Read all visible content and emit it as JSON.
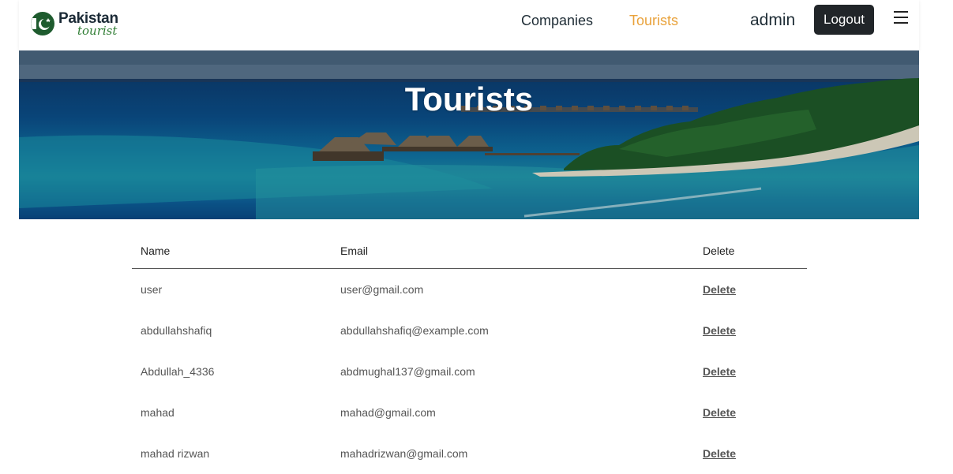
{
  "brand": {
    "main": "Pakistan",
    "sub": "tourist"
  },
  "nav": {
    "companies": "Companies",
    "tourists": "Tourists",
    "user": "admin",
    "logout": "Logout"
  },
  "hero": {
    "title": "Tourists"
  },
  "table": {
    "headers": {
      "name": "Name",
      "email": "Email",
      "delete": "Delete"
    },
    "rows": [
      {
        "name": "user",
        "email": "user@gmail.com",
        "action": "Delete"
      },
      {
        "name": "abdullahshafiq",
        "email": "abdullahshafiq@example.com",
        "action": "Delete"
      },
      {
        "name": "Abdullah_4336",
        "email": "abdmughal137@gmail.com",
        "action": "Delete"
      },
      {
        "name": "mahad",
        "email": "mahad@gmail.com",
        "action": "Delete"
      },
      {
        "name": "mahad rizwan",
        "email": "mahadrizwan@gmail.com",
        "action": "Delete"
      }
    ]
  },
  "colors": {
    "accent": "#e9a23b",
    "logout_bg": "#212529",
    "brand_green": "#2f7d33"
  },
  "icons": {
    "logo": "pakistan-flag-logo",
    "menu": "hamburger-icon"
  }
}
